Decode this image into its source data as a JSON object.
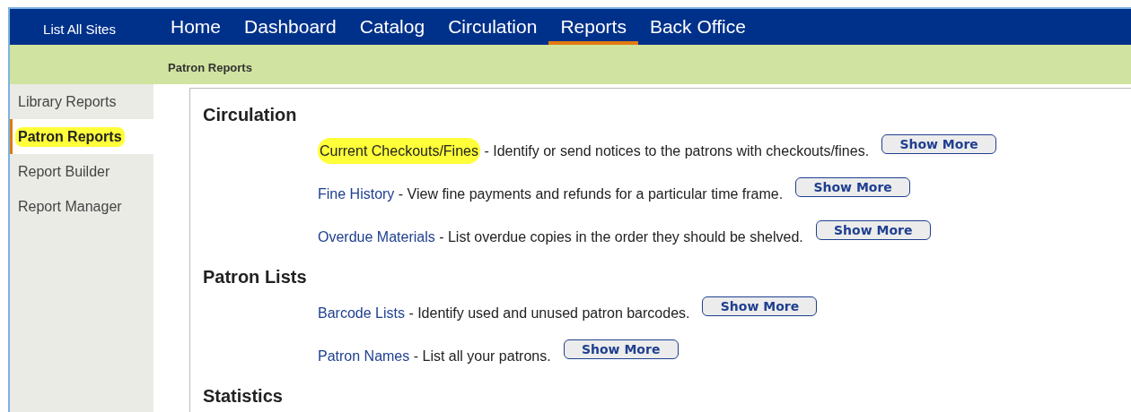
{
  "site_switch": {
    "label": "List All Sites",
    "selected": false
  },
  "tabs": [
    {
      "label": "Home",
      "selected": false
    },
    {
      "label": "Dashboard",
      "selected": false
    },
    {
      "label": "Catalog",
      "selected": false
    },
    {
      "label": "Circulation",
      "selected": false
    },
    {
      "label": "Reports",
      "selected": true
    },
    {
      "label": "Back Office",
      "selected": false
    }
  ],
  "breadcrumb": "Patron Reports",
  "sidebar": {
    "items": [
      {
        "label": "Library Reports",
        "selected": false,
        "highlighted": false
      },
      {
        "label": "Patron Reports",
        "selected": true,
        "highlighted": true
      },
      {
        "label": "Report Builder",
        "selected": false,
        "highlighted": false
      },
      {
        "label": "Report Manager",
        "selected": false,
        "highlighted": false
      }
    ]
  },
  "sections": [
    {
      "title": "Circulation",
      "reports": [
        {
          "link": "Current Checkouts/Fines",
          "description": " - Identify or send notices to the patrons with checkouts/fines.",
          "button": "Show More",
          "highlighted": true
        },
        {
          "link": "Fine History",
          "description": " - View fine payments and refunds for a particular time frame.",
          "button": "Show More",
          "highlighted": false
        },
        {
          "link": "Overdue Materials",
          "description": " - List overdue copies in the order they should be shelved.",
          "button": "Show More",
          "highlighted": false
        }
      ]
    },
    {
      "title": "Patron Lists",
      "reports": [
        {
          "link": "Barcode Lists",
          "description": " - Identify used and unused patron barcodes.",
          "button": "Show More",
          "highlighted": false
        },
        {
          "link": "Patron Names",
          "description": " - List all your patrons.",
          "button": "Show More",
          "highlighted": false
        }
      ]
    },
    {
      "title": "Statistics"
    }
  ]
}
